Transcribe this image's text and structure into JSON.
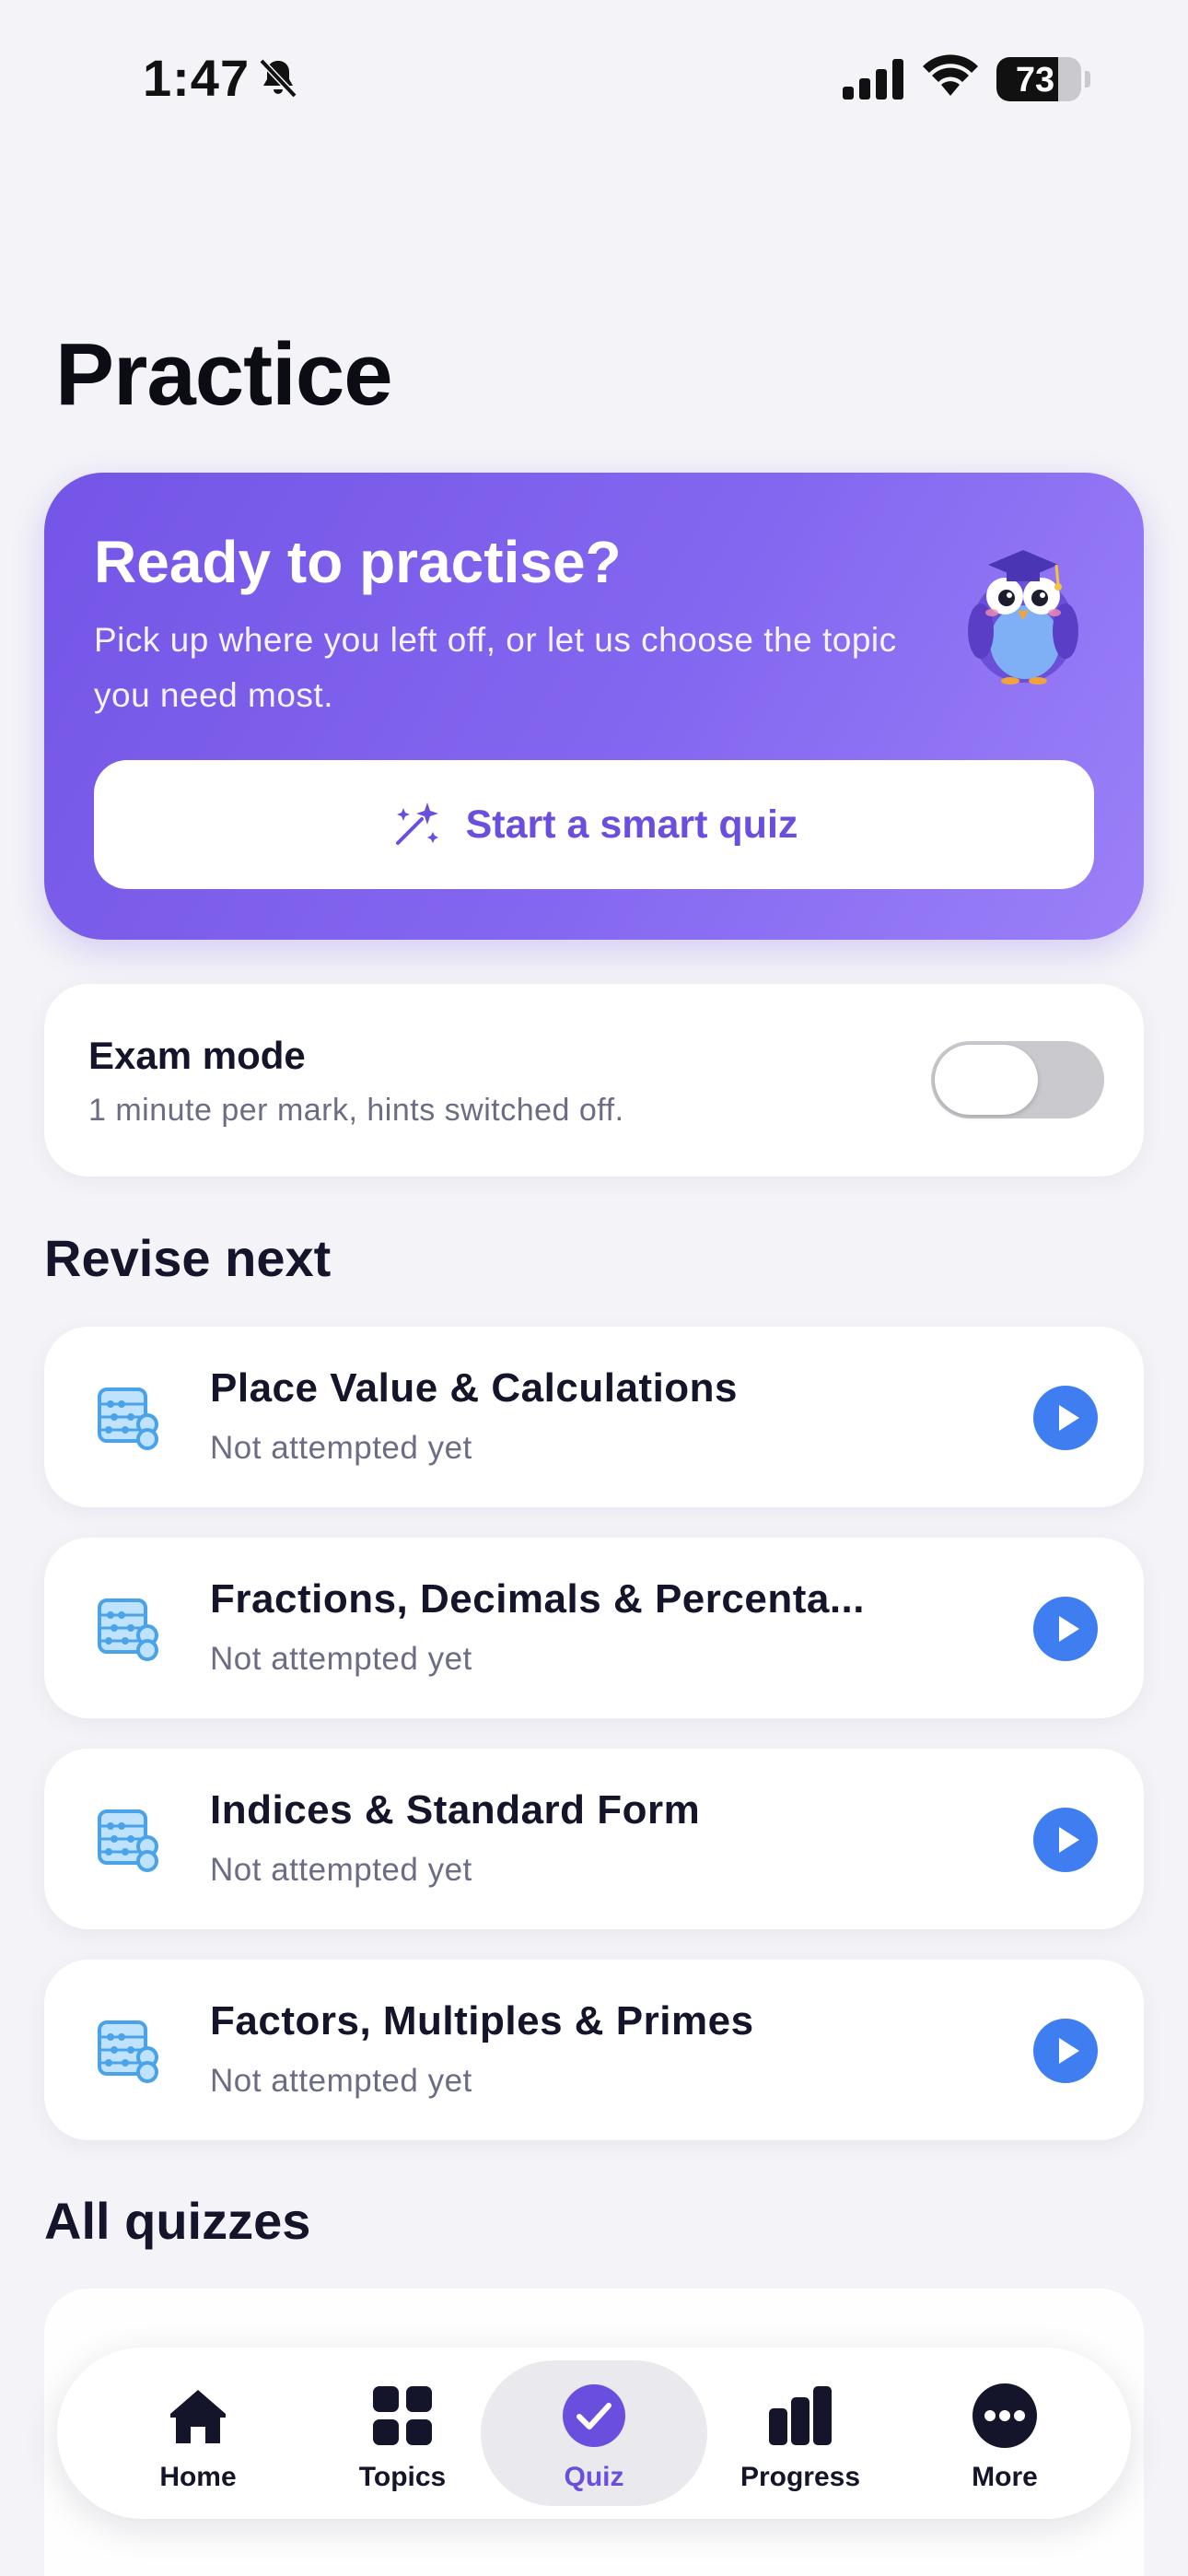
{
  "status_bar": {
    "time": "1:47",
    "battery_level": "73",
    "battery_fraction": 0.73
  },
  "page": {
    "title": "Practice"
  },
  "hero": {
    "title": "Ready to practise?",
    "subtitle": "Pick up where you left off, or let us choose the topic you need most.",
    "button_label": "Start a smart quiz",
    "button_icon": "sparkle-icon",
    "mascot": "owl-graduate"
  },
  "exam_mode": {
    "title": "Exam mode",
    "description": "1 minute per mark, hints switched off.",
    "enabled": false
  },
  "revise_next": {
    "title": "Revise next",
    "items": [
      {
        "name": "Place Value & Calculations",
        "status": "Not attempted yet",
        "icon": "abacus-icon"
      },
      {
        "name": "Fractions, Decimals & Percenta...",
        "status": "Not attempted yet",
        "icon": "abacus-icon"
      },
      {
        "name": "Indices & Standard Form",
        "status": "Not attempted yet",
        "icon": "abacus-icon"
      },
      {
        "name": "Factors, Multiples & Primes",
        "status": "Not attempted yet",
        "icon": "abacus-icon"
      }
    ]
  },
  "all_quizzes": {
    "title": "All quizzes"
  },
  "tab_bar": {
    "active": "Quiz",
    "tabs": [
      {
        "label": "Home",
        "icon": "home-icon"
      },
      {
        "label": "Topics",
        "icon": "grid-icon"
      },
      {
        "label": "Quiz",
        "icon": "check-circle-icon"
      },
      {
        "label": "Progress",
        "icon": "bar-chart-icon"
      },
      {
        "label": "More",
        "icon": "more-icon"
      }
    ]
  },
  "colors": {
    "accent": "#6a4fde",
    "hero_gradient_start": "#7455e6",
    "hero_gradient_end": "#9b80f8",
    "play_blue": "#3e7ef0",
    "background": "#f4f4f8"
  }
}
